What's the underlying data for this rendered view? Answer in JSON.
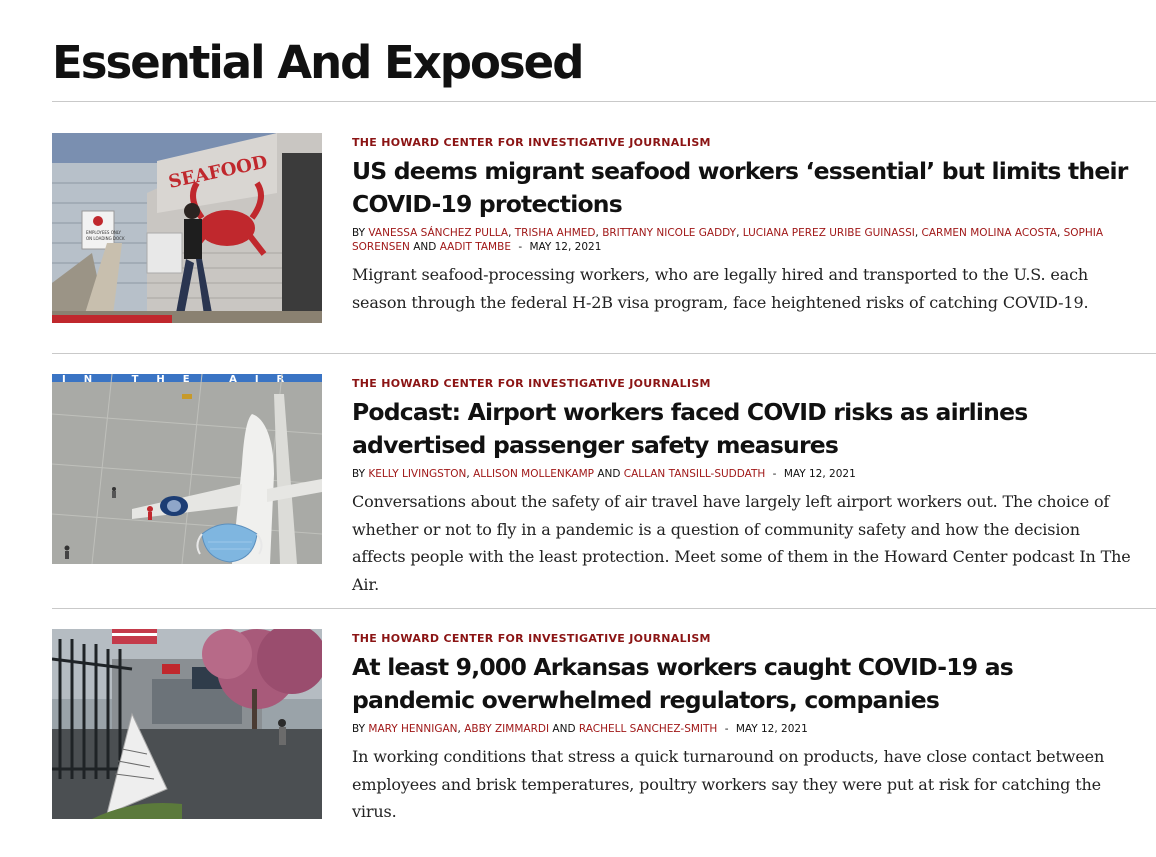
{
  "page": {
    "title": "Essential And Exposed"
  },
  "articles": [
    {
      "kicker": "The Howard Center for Investigative Journalism",
      "headline": "US deems migrant seafood workers ‘essential’ but limits their COVID-19 protections",
      "by": "BY",
      "authors": [
        "Vanessa Sánchez Pulla",
        "Trisha Ahmed",
        "Brittany Nicole Gaddy",
        "Luciana Perez Uribe Guinassi",
        "Carmen Molina Acosta",
        "Sophia Sorensen",
        "Aadit Tambe"
      ],
      "and": "AND",
      "separator": "-",
      "date": "May 12, 2021",
      "dek": "Migrant seafood-processing workers, who are legally hired and transported to the U.S. each season through the federal H-2B visa program, face heightened risks of catching COVID-19.",
      "image_text": {
        "sign": "SEAFOOD",
        "notice_1": "EMPLOYEES ONLY",
        "notice_2": "ON LOADING DOCK"
      }
    },
    {
      "kicker": "The Howard Center for Investigative Journalism",
      "headline": "Podcast: Airport workers faced COVID risks as airlines advertised passenger safety measures",
      "by": "BY",
      "authors": [
        "Kelly Livingston",
        "Allison Mollenkamp",
        "Callan Tansill-Suddath"
      ],
      "and": "AND",
      "separator": "-",
      "date": "May 12, 2021",
      "dek": "Conversations about the safety of air travel have largely left airport workers out. The choice of whether or not to fly in a pandemic is a question of community safety and how the decision affects people with the least protection. Meet some of them in the Howard Center podcast In The Air.",
      "image_text": {
        "banner": "IN THE AIR"
      }
    },
    {
      "kicker": "The Howard Center for Investigative Journalism",
      "headline": "At least 9,000 Arkansas workers caught COVID-19 as pandemic overwhelmed regulators, companies",
      "by": "BY",
      "authors": [
        "Mary Hennigan",
        "Abby Zimmardi",
        "Rachell Sanchez-Smith"
      ],
      "and": "AND",
      "separator": "-",
      "date": "May 12, 2021",
      "dek": "In working conditions that stress a quick turnaround on products, have close contact between employees and brisk temperatures, poultry workers say they were put at risk for catching the virus.",
      "image_text": {}
    }
  ],
  "colors": {
    "kicker": "#8b1414",
    "author": "#a01818",
    "rule": "#c9c9c9",
    "text": "#111111"
  }
}
